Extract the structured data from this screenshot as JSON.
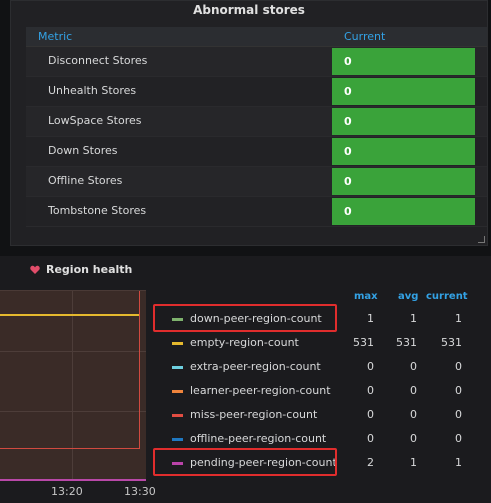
{
  "abnormal_stores": {
    "title": "Abnormal stores",
    "columns": {
      "metric": "Metric",
      "current": "Current"
    },
    "rows": [
      {
        "label": "Disconnect Stores",
        "value": "0"
      },
      {
        "label": "Unhealth Stores",
        "value": "0"
      },
      {
        "label": "LowSpace Stores",
        "value": "0"
      },
      {
        "label": "Down Stores",
        "value": "0"
      },
      {
        "label": "Offline Stores",
        "value": "0"
      },
      {
        "label": "Tombstone Stores",
        "value": "0"
      }
    ],
    "value_color": "#3aa33a"
  },
  "region_health": {
    "title": "Region health",
    "x_ticks": [
      "13:20",
      "13:30"
    ],
    "legend_columns": {
      "max": "max",
      "avg": "avg",
      "current": "current"
    },
    "series": [
      {
        "name": "down-peer-region-count",
        "color": "#7eb26d",
        "max": "1",
        "avg": "1",
        "current": "1",
        "highlighted": true
      },
      {
        "name": "empty-region-count",
        "color": "#e5b92e",
        "max": "531",
        "avg": "531",
        "current": "531",
        "highlighted": false
      },
      {
        "name": "extra-peer-region-count",
        "color": "#6ed0e0",
        "max": "0",
        "avg": "0",
        "current": "0",
        "highlighted": false
      },
      {
        "name": "learner-peer-region-count",
        "color": "#ef843c",
        "max": "0",
        "avg": "0",
        "current": "0",
        "highlighted": false
      },
      {
        "name": "miss-peer-region-count",
        "color": "#e24d42",
        "max": "0",
        "avg": "0",
        "current": "0",
        "highlighted": false
      },
      {
        "name": "offline-peer-region-count",
        "color": "#1f78c1",
        "max": "0",
        "avg": "0",
        "current": "0",
        "highlighted": false
      },
      {
        "name": "pending-peer-region-count",
        "color": "#ba43a9",
        "max": "2",
        "avg": "1",
        "current": "1",
        "highlighted": true
      }
    ],
    "highlight_color": "#e02d2d"
  }
}
